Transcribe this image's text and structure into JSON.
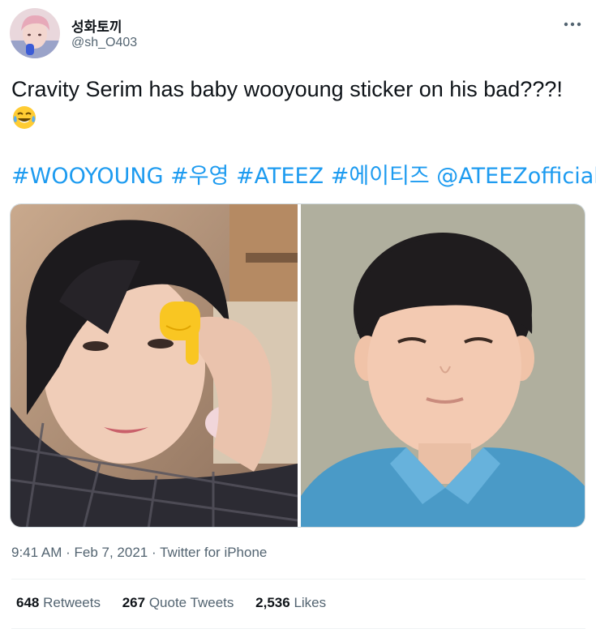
{
  "author": {
    "display_name": "성화토끼",
    "handle": "@sh_O403",
    "avatar_icon": "profile-avatar"
  },
  "tweet": {
    "text": "Cravity Serim has baby wooyoung sticker on his bad???!",
    "emoji": "face-with-tears-of-joy",
    "hashtags": [
      "#WOOYOUNG",
      "#우영",
      "#ATEEZ",
      "#에이티즈",
      "@ATEEZofficial"
    ]
  },
  "media": [
    {
      "name": "selfie-photo",
      "pointing_emoji": "backhand-index-pointing-down"
    },
    {
      "name": "childhood-photo"
    }
  ],
  "meta": {
    "time": "9:41 AM",
    "separator": "·",
    "date": "Feb 7, 2021",
    "source": "Twitter for iPhone"
  },
  "stats": {
    "retweets_count": "648",
    "retweets_label": "Retweets",
    "quotes_count": "267",
    "quotes_label": "Quote Tweets",
    "likes_count": "2,536",
    "likes_label": "Likes"
  },
  "colors": {
    "link": "#1d9bf0",
    "secondary_text": "#536471",
    "primary_text": "#0f1419"
  }
}
